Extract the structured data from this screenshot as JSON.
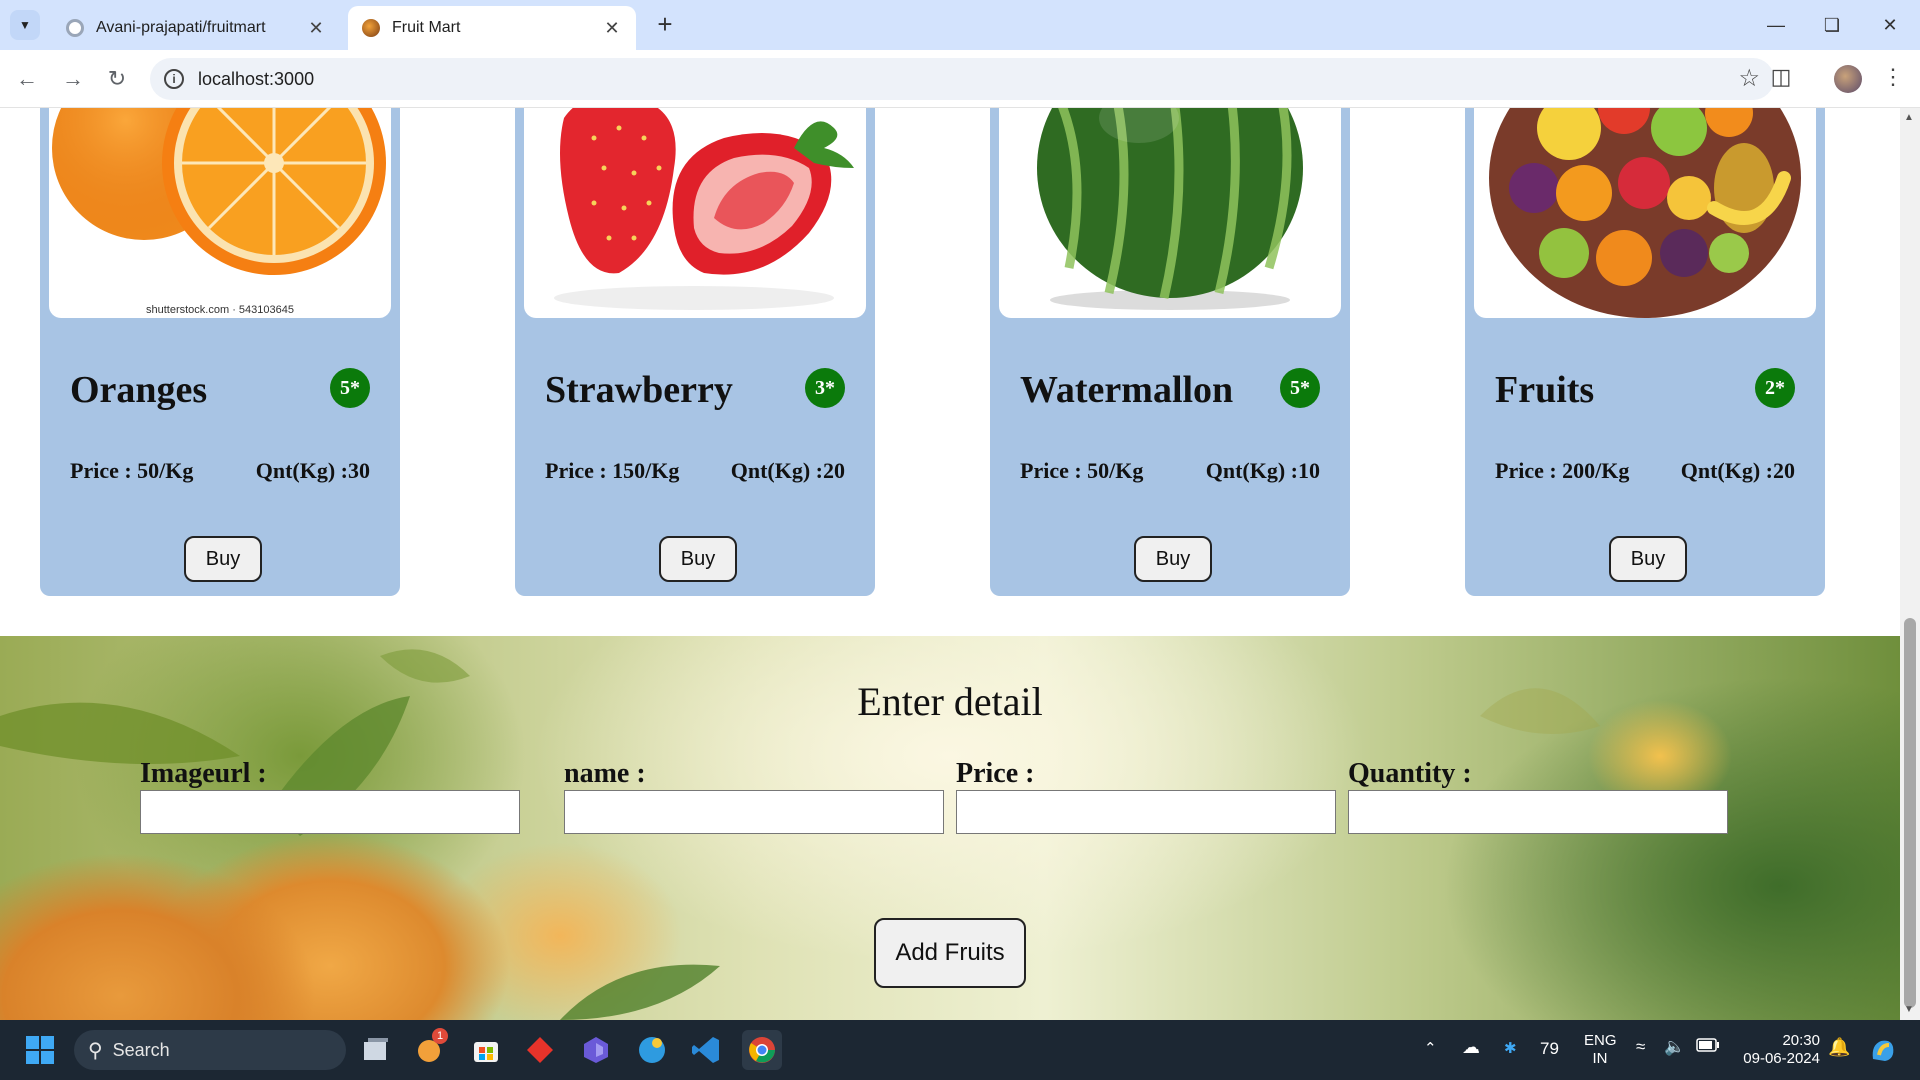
{
  "browser": {
    "tabs": [
      {
        "title": "Avani-prajapati/fruitmart",
        "active": false,
        "icon": "github-icon"
      },
      {
        "title": "Fruit Mart",
        "active": true,
        "icon": "fruit-favicon"
      }
    ],
    "url": "localhost:3000"
  },
  "products": [
    {
      "name": "Oranges",
      "rating": "5*",
      "price": "Price : 50/Kg",
      "qty": "Qnt(Kg) :30",
      "buy": "Buy",
      "image_caption": "shutterstock.com · 543103645"
    },
    {
      "name": "Strawberry",
      "rating": "3*",
      "price": "Price : 150/Kg",
      "qty": "Qnt(Kg) :20",
      "buy": "Buy"
    },
    {
      "name": "Watermallon",
      "rating": "5*",
      "price": "Price : 50/Kg",
      "qty": "Qnt(Kg) :10",
      "buy": "Buy"
    },
    {
      "name": "Fruits",
      "rating": "2*",
      "price": "Price : 200/Kg",
      "qty": "Qnt(Kg) :20",
      "buy": "Buy"
    }
  ],
  "form": {
    "title": "Enter detail",
    "fields": [
      {
        "label": "Imageurl :",
        "value": ""
      },
      {
        "label": "name :",
        "value": ""
      },
      {
        "label": "Price :",
        "value": ""
      },
      {
        "label": "Quantity :",
        "value": ""
      }
    ],
    "submit": "Add Fruits"
  },
  "taskbar": {
    "search": "Search",
    "store_badge": "1",
    "temperature": "79",
    "lang_line1": "ENG",
    "lang_line2": "IN",
    "time": "20:30",
    "date": "09-06-2024"
  },
  "colors": {
    "card_bg": "#a8c4e4",
    "badge_bg": "#0b7a0b",
    "tabstrip_bg": "#d3e3fd",
    "taskbar_bg": "#1c2733"
  }
}
